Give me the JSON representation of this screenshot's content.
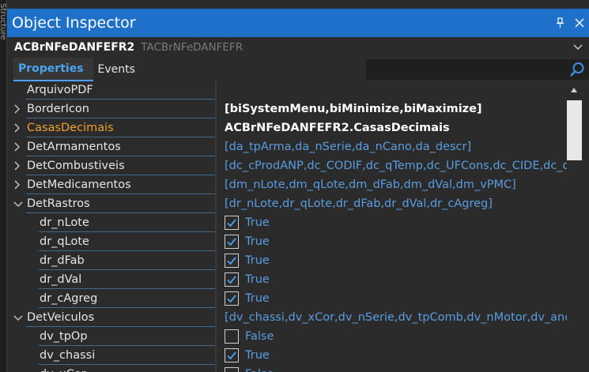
{
  "side_strip_text": "Structure",
  "window": {
    "title": "Object Inspector",
    "pin_icon": "pin-icon",
    "close_icon": "close-icon"
  },
  "object_selector": {
    "name": "ACBrNFeDANFEFR2",
    "class_name": "TACBrNFeDANFEFR"
  },
  "tabs": [
    {
      "label": "Properties",
      "active": true
    },
    {
      "label": "Events",
      "active": false
    }
  ],
  "search": {
    "value": "",
    "placeholder": ""
  },
  "properties": [
    {
      "name": "ArquivoPDF",
      "value": "",
      "indent": 0,
      "expander": "none"
    },
    {
      "name": "BorderIcon",
      "value": "[biSystemMenu,biMinimize,biMaximize]",
      "value_style": "bold",
      "indent": 0,
      "expander": "collapsed"
    },
    {
      "name": "CasasDecimais",
      "value": "ACBrNFeDANFEFR2.CasasDecimais",
      "value_style": "bold",
      "indent": 0,
      "expander": "collapsed",
      "highlight": true
    },
    {
      "name": "DetArmamentos",
      "value": "[da_tpArma,da_nSerie,da_nCano,da_descr]",
      "indent": 0,
      "expander": "collapsed"
    },
    {
      "name": "DetCombustiveis",
      "value": "[dc_cProdANP,dc_CODIF,dc_qTemp,dc_UFCons,dc_CIDE,dc_qBCProd]",
      "indent": 0,
      "expander": "collapsed"
    },
    {
      "name": "DetMedicamentos",
      "value": "[dm_nLote,dm_qLote,dm_dFab,dm_dVal,dm_vPMC]",
      "indent": 0,
      "expander": "collapsed"
    },
    {
      "name": "DetRastros",
      "value": "[dr_nLote,dr_qLote,dr_dFab,dr_dVal,dr_cAgreg]",
      "indent": 0,
      "expander": "expanded"
    },
    {
      "name": "dr_nLote",
      "value": "True",
      "checked": true,
      "indent": 1,
      "expander": "none",
      "type": "bool"
    },
    {
      "name": "dr_qLote",
      "value": "True",
      "checked": true,
      "indent": 1,
      "expander": "none",
      "type": "bool"
    },
    {
      "name": "dr_dFab",
      "value": "True",
      "checked": true,
      "indent": 1,
      "expander": "none",
      "type": "bool"
    },
    {
      "name": "dr_dVal",
      "value": "True",
      "checked": true,
      "indent": 1,
      "expander": "none",
      "type": "bool"
    },
    {
      "name": "dr_cAgreg",
      "value": "True",
      "checked": true,
      "indent": 1,
      "expander": "none",
      "type": "bool"
    },
    {
      "name": "DetVeiculos",
      "value": "[dv_chassi,dv_xCor,dv_nSerie,dv_tpComb,dv_nMotor,dv_anoMod,dv",
      "indent": 0,
      "expander": "expanded"
    },
    {
      "name": "dv_tpOp",
      "value": "False",
      "checked": false,
      "indent": 1,
      "expander": "none",
      "type": "bool"
    },
    {
      "name": "dv_chassi",
      "value": "True",
      "checked": true,
      "indent": 1,
      "expander": "none",
      "type": "bool"
    },
    {
      "name": "dv_xCor",
      "value": "False",
      "checked": false,
      "indent": 1,
      "expander": "none",
      "type": "bool"
    }
  ],
  "colors": {
    "title_bar": "#1e70c8",
    "active_tab_text": "#4ba3f0",
    "highlight_name": "#f0a030",
    "value_text": "#5a9ce0"
  }
}
